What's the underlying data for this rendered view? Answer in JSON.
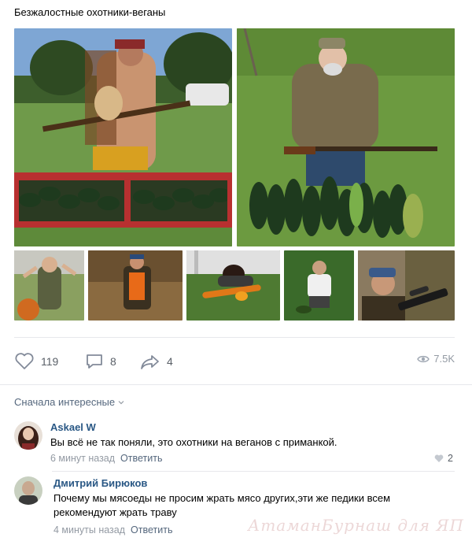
{
  "post": {
    "title": "Безжалостные охотники-веганы"
  },
  "photos": [
    {
      "name": "hunter-longhair-zucchini",
      "scene": "hunter with rifle and dog behind crate of zucchini"
    },
    {
      "name": "hunter-camo-zucchini",
      "scene": "hunter in camo with rifle kneeling by zucchini"
    },
    {
      "name": "hunter-pumpkin",
      "scene": "hunter with pumpkin"
    },
    {
      "name": "hunter-orange-vest",
      "scene": "hunter in orange vest in leaves"
    },
    {
      "name": "hunter-lying-carrot",
      "scene": "hunter lying with carrot"
    },
    {
      "name": "hunter-garden-crouch",
      "scene": "hunter crouching in garden"
    },
    {
      "name": "hunter-cap-scope",
      "scene": "hunter in cap with scoped rifle"
    }
  ],
  "actions": {
    "likes": "119",
    "comments": "8",
    "shares": "4",
    "views": "7.5K"
  },
  "sort_label": "Сначала интересные",
  "comments": [
    {
      "author": "Askael W",
      "text": "Вы всё не так поняли, это охотники на веганов с приманкой.",
      "time": "6 минут назад",
      "reply": "Ответить",
      "likes": "2"
    },
    {
      "author": "Дмитрий Бирюков",
      "text": "Почему мы мясоеды не просим жрать мясо других,эти же педики всем рекомендуют жрать траву",
      "time": "4 минуты назад",
      "reply": "Ответить"
    }
  ],
  "watermark": "АтаманБурнаш для ЯП",
  "colors": {
    "link": "#2a5885",
    "muted": "#939aa3",
    "divider": "#e7e8ec",
    "icon": "#828a99"
  }
}
